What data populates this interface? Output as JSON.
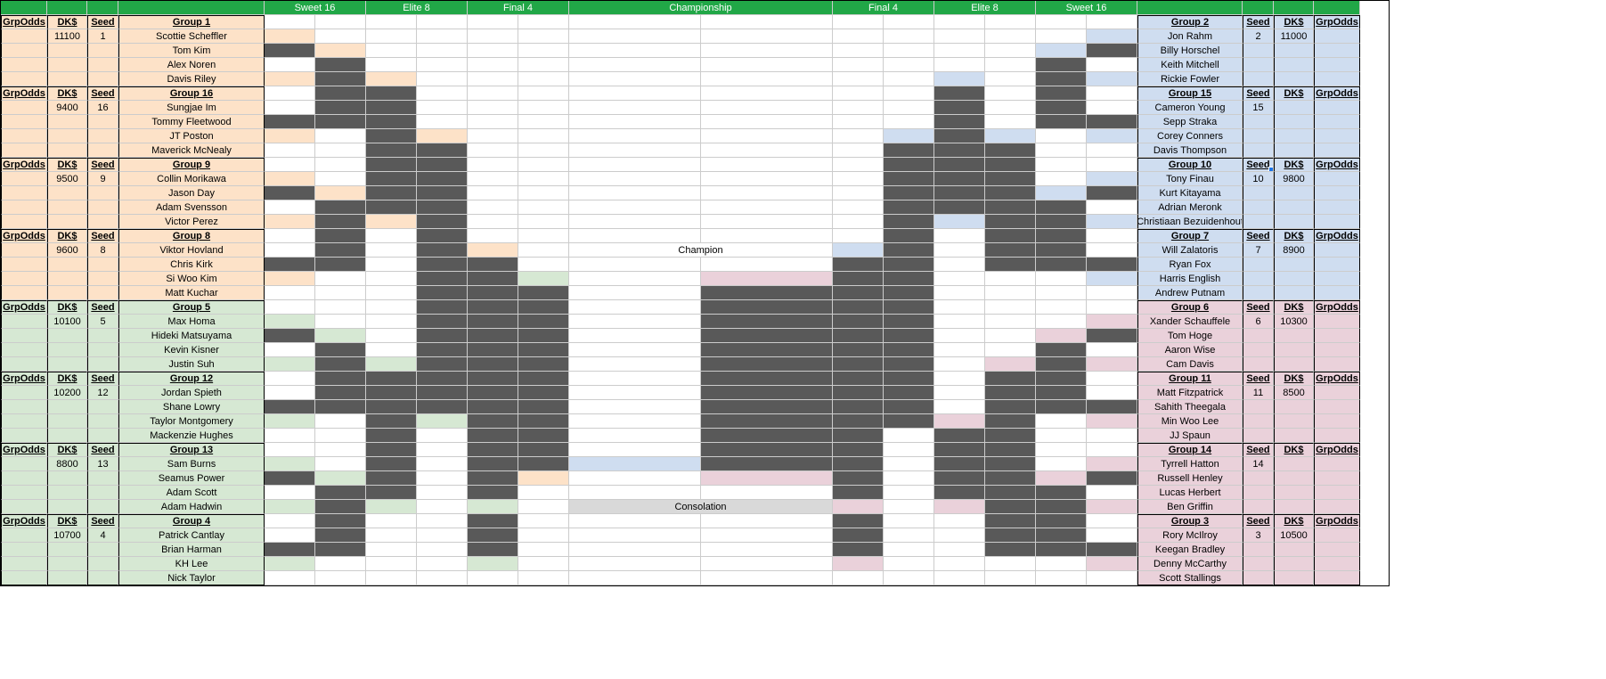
{
  "rounds": {
    "s16l": "Sweet 16",
    "e8l": "Elite 8",
    "f4l": "Final 4",
    "champ": "Championship",
    "f4r": "Final 4",
    "e8r": "Elite 8",
    "s16r": "Sweet 16"
  },
  "hdr": {
    "grpodds": "GrpOdds",
    "dk": "DK$",
    "seed": "Seed"
  },
  "center": {
    "champion": "Champion",
    "consolation": "Consolation"
  },
  "left": [
    {
      "color": "peach",
      "group": "Group 1",
      "dk": "11100",
      "seed": "1",
      "p": [
        "Scottie Scheffler",
        "Tom Kim",
        "Alex Noren",
        "Davis Riley"
      ]
    },
    {
      "color": "peach",
      "group": "Group 16",
      "dk": "9400",
      "seed": "16",
      "p": [
        "Sungjae Im",
        "Tommy Fleetwood",
        "JT Poston",
        "Maverick McNealy"
      ]
    },
    {
      "color": "peach",
      "group": "Group 9",
      "dk": "9500",
      "seed": "9",
      "p": [
        "Collin Morikawa",
        "Jason Day",
        "Adam Svensson",
        "Victor Perez"
      ]
    },
    {
      "color": "peach",
      "group": "Group 8",
      "dk": "9600",
      "seed": "8",
      "p": [
        "Viktor Hovland",
        "Chris Kirk",
        "Si Woo Kim",
        "Matt Kuchar"
      ]
    },
    {
      "color": "green",
      "group": "Group 5",
      "dk": "10100",
      "seed": "5",
      "p": [
        "Max Homa",
        "Hideki Matsuyama",
        "Kevin Kisner",
        "Justin Suh"
      ]
    },
    {
      "color": "green",
      "group": "Group 12",
      "dk": "10200",
      "seed": "12",
      "p": [
        "Jordan Spieth",
        "Shane Lowry",
        "Taylor Montgomery",
        "Mackenzie Hughes"
      ]
    },
    {
      "color": "green",
      "group": "Group 13",
      "dk": "8800",
      "seed": "13",
      "p": [
        "Sam Burns",
        "Seamus Power",
        "Adam Scott",
        "Adam Hadwin"
      ]
    },
    {
      "color": "green",
      "group": "Group 4",
      "dk": "10700",
      "seed": "4",
      "p": [
        "Patrick Cantlay",
        "Brian Harman",
        "KH Lee",
        "Nick Taylor"
      ]
    }
  ],
  "right": [
    {
      "color": "blue",
      "group": "Group 2",
      "dk": "11000",
      "seed": "2",
      "p": [
        "Jon Rahm",
        "Billy Horschel",
        "Keith Mitchell",
        "Rickie Fowler"
      ]
    },
    {
      "color": "blue",
      "group": "Group 15",
      "dk": "",
      "seed": "15",
      "p": [
        "Cameron Young",
        "Sepp Straka",
        "Corey Conners",
        "Davis Thompson"
      ]
    },
    {
      "color": "blue",
      "group": "Group 10",
      "dk": "9800",
      "seed": "10",
      "p": [
        "Tony Finau",
        "Kurt Kitayama",
        "Adrian Meronk",
        "Christiaan Bezuidenhout"
      ]
    },
    {
      "color": "blue",
      "group": "Group 7",
      "dk": "8900",
      "seed": "7",
      "p": [
        "Will Zalatoris",
        "Ryan Fox",
        "Harris English",
        "Andrew Putnam"
      ]
    },
    {
      "color": "pink",
      "group": "Group 6",
      "dk": "10300",
      "seed": "6",
      "p": [
        "Xander Schauffele",
        "Tom Hoge",
        "Aaron Wise",
        "Cam Davis"
      ]
    },
    {
      "color": "pink",
      "group": "Group 11",
      "dk": "8500",
      "seed": "11",
      "p": [
        "Matt Fitzpatrick",
        "Sahith Theegala",
        "Min Woo Lee",
        "JJ Spaun"
      ]
    },
    {
      "color": "pink",
      "group": "Group 14",
      "dk": "",
      "seed": "14",
      "p": [
        "Tyrrell Hatton",
        "Russell Henley",
        "Lucas Herbert",
        "Ben Griffin"
      ]
    },
    {
      "color": "pink",
      "group": "Group 3",
      "dk": "10500",
      "seed": "3",
      "p": [
        "Rory McIlroy",
        "Keegan Bradley",
        "Denny McCarthy",
        "Scott Stallings"
      ]
    }
  ]
}
